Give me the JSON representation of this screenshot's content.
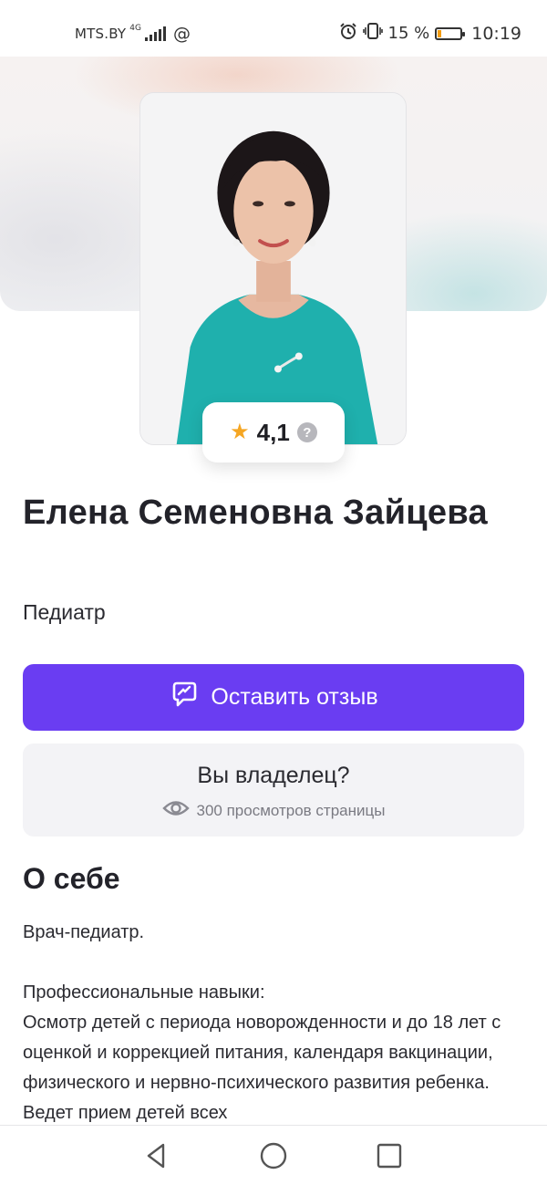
{
  "status_bar": {
    "carrier": "MTS.BY",
    "network": "4G",
    "at_symbol": "@",
    "battery_percent_text": "15 %",
    "battery_level": 0.15,
    "time": "10:19",
    "icons": [
      "signal-icon",
      "alarm-icon",
      "vibrate-icon",
      "battery-icon"
    ]
  },
  "profile": {
    "rating": "4,1",
    "rating_icon": "star-icon",
    "help_icon_text": "?",
    "name": "Елена Семеновна Зайцева",
    "specialty": "Педиатр"
  },
  "actions": {
    "review_label": "Оставить отзыв",
    "review_icon": "chat-bubble-icon",
    "owner_title": "Вы владелец?",
    "views_text": "300 просмотров страницы",
    "views_icon": "eye-icon"
  },
  "about": {
    "title": "О себе",
    "intro": "Врач-педиатр.",
    "skills_heading": "Профессиональные навыки:",
    "skills_text": "Осмотр детей с периода новорожденности и до 18 лет с оценкой и коррекцией питания, календаря вакцинации, физического и нервно-психического развития ребенка. Ведет прием детей всех"
  },
  "colors": {
    "accent": "#6a3df2",
    "star": "#f5a623",
    "owner_bg": "#f3f3f6"
  },
  "nav_bar": {
    "buttons": [
      "back-icon",
      "home-icon",
      "recents-icon"
    ]
  }
}
